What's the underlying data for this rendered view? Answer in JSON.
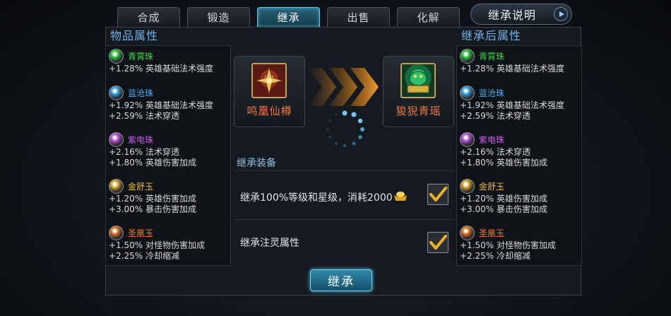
{
  "tabs": [
    {
      "label": "合成"
    },
    {
      "label": "锻造"
    },
    {
      "label": "继承",
      "active": true
    },
    {
      "label": "出售"
    },
    {
      "label": "化解"
    }
  ],
  "help_button": {
    "label": "继承说明"
  },
  "left_panel": {
    "title": "物品属性",
    "gems": [
      {
        "name": "青霄珠",
        "color": "#37d64a",
        "icon": "green-orb-icon",
        "stats": [
          "+1.28% 英雄基础法术强度"
        ]
      },
      {
        "name": "蓝沧珠",
        "color": "#3fb0f2",
        "icon": "blue-orb-icon",
        "stats": [
          "+1.92% 英雄基础法术强度",
          "+2.59% 法术穿透"
        ]
      },
      {
        "name": "紫电珠",
        "color": "#cc5cf0",
        "icon": "purple-orb-icon",
        "stats": [
          "+2.16% 法术穿透",
          "+1.80% 英雄伤害加成"
        ]
      },
      {
        "name": "金舒玉",
        "color": "#e8b83a",
        "icon": "gold-jade-icon",
        "stats": [
          "+1.20% 英雄伤害加成",
          "+3.00% 暴击伤害加成"
        ]
      },
      {
        "name": "圣凰玉",
        "color": "#f27a2e",
        "icon": "orange-jade-icon",
        "stats": [
          "+1.50% 对怪物伤害加成",
          "+2.25% 冷却缩减"
        ]
      }
    ]
  },
  "right_panel": {
    "title": "继承后属性",
    "gems": [
      {
        "name": "青霄珠",
        "color": "#37d64a",
        "icon": "green-orb-icon",
        "stats": [
          "+1.28% 英雄基础法术强度"
        ]
      },
      {
        "name": "蓝沧珠",
        "color": "#3fb0f2",
        "icon": "blue-orb-icon",
        "stats": [
          "+1.92% 英雄基础法术强度",
          "+2.59% 法术穿透"
        ]
      },
      {
        "name": "紫电珠",
        "color": "#cc5cf0",
        "icon": "purple-orb-icon",
        "stats": [
          "+2.16% 法术穿透",
          "+1.80% 英雄伤害加成"
        ]
      },
      {
        "name": "金舒玉",
        "color": "#e8b83a",
        "icon": "gold-jade-icon",
        "stats": [
          "+1.20% 英雄伤害加成",
          "+3.00% 暴击伤害加成"
        ]
      },
      {
        "name": "圣凰玉",
        "color": "#f27a2e",
        "icon": "orange-jade-icon",
        "stats": [
          "+1.50% 对怪物伤害加成",
          "+2.25% 冷却缩减"
        ]
      }
    ]
  },
  "source_item": {
    "name": "鸣凰仙樽",
    "icon": "golden-cross-weapon-icon"
  },
  "target_item": {
    "name": "狻猊青瑶",
    "icon": "jade-beast-icon"
  },
  "equip": {
    "title": "继承装备",
    "options": [
      {
        "label": "继承100%等级和星级，消耗2000",
        "currency_icon": "gold-ingot-icon",
        "checked": true
      },
      {
        "label": "继承注灵属性",
        "checked": true
      }
    ]
  },
  "action_button": {
    "label": "继承"
  },
  "colors": {
    "accent": "#3aa8d0",
    "title_blue": "#6cb4e8",
    "item_name": "#f07a3a",
    "check_gold": "#f0b020"
  }
}
